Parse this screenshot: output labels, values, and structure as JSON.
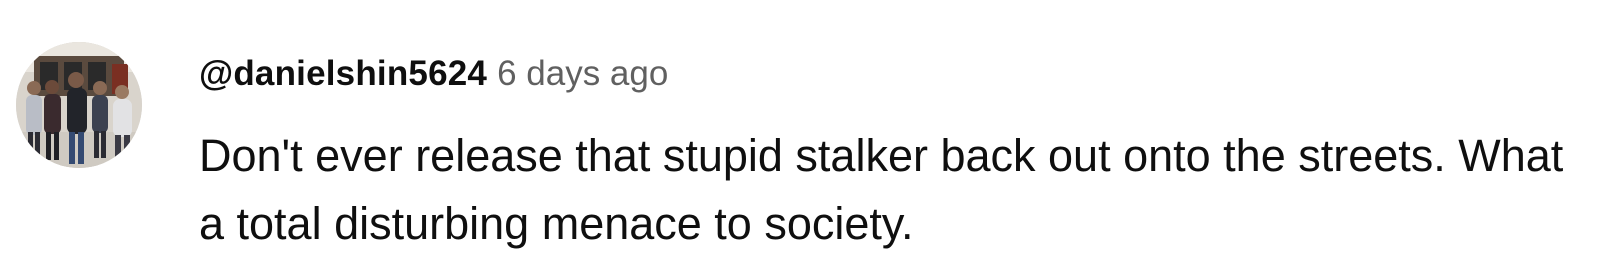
{
  "comment": {
    "avatar_icon": "user-avatar-photo",
    "author": "@danielshin5624",
    "timestamp": "6 days ago",
    "text": "Don't ever release that stupid stalker back out onto the streets. What a total disturbing menace to society."
  },
  "colors": {
    "author_text": "#0f0f0f",
    "timestamp_text": "#606060",
    "comment_text": "#0f0f0f",
    "background": "#ffffff"
  }
}
